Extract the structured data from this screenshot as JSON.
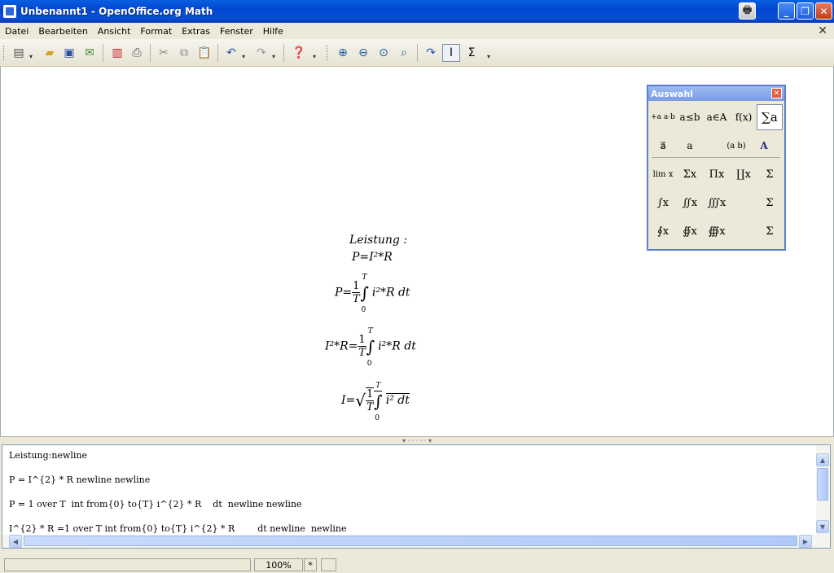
{
  "window": {
    "title": "Unbenannt1 - OpenOffice.org Math"
  },
  "menubar": {
    "items": [
      {
        "label": "Datei"
      },
      {
        "label": "Bearbeiten"
      },
      {
        "label": "Ansicht"
      },
      {
        "label": "Format"
      },
      {
        "label": "Extras"
      },
      {
        "label": "Fenster"
      },
      {
        "label": "Hilfe"
      }
    ],
    "close_glyph": "✕"
  },
  "toolbar": {
    "icons": [
      "new-document-icon",
      "open-folder-icon",
      "save-icon",
      "mail-icon",
      "export-pdf-icon",
      "print-icon",
      "cut-icon",
      "copy-icon",
      "paste-icon",
      "undo-icon",
      "redo-icon",
      "help-icon",
      "zoom-in-icon",
      "zoom-out-icon",
      "zoom-100-icon",
      "zoom-icon",
      "update-icon",
      "formula-cursor-icon",
      "selection-sigma-icon"
    ],
    "sigma_label": "Σ"
  },
  "formulas": {
    "leistung": "Leistung :",
    "f1": "P=I²*R",
    "f2_left": "P=",
    "f2_num": "1",
    "f2_den": "T",
    "f2_up": "T",
    "f2_lo": "0",
    "f2_right": "i²*R dt",
    "f3_left": "I²*R=",
    "f3_num": "1",
    "f3_den": "T",
    "f3_up": "T",
    "f3_lo": "0",
    "f3_right": "i²*R dt",
    "f4_left": "I=",
    "f4_num": "1",
    "f4_den": "T",
    "f4_up": "T",
    "f4_lo": "0",
    "f4_right": "i² dt"
  },
  "auswahl": {
    "title": "Auswahl",
    "categories": [
      "+a a·b",
      "a≤b",
      "a∈A",
      "f(x)",
      "∑a",
      "a⃗",
      "a",
      "(a b)",
      "A"
    ],
    "symbols": [
      "lim x",
      "Σx",
      "Πx",
      "∐x",
      "Σ",
      "∫x",
      "∬x",
      "∭x",
      "Σ",
      "∮x",
      "∯x",
      "∰x",
      "Σ"
    ]
  },
  "commands": {
    "lines": [
      "Leistung:newline",
      "P = I^{2} * R newline newline",
      "P = 1 over T  int from{0} to{T} i^{2} * R    dt  newline newline",
      "I^{2} * R =1 over T int from{0} to{T} i^{2} * R        dt newline  newline"
    ]
  },
  "status": {
    "zoom": "100%",
    "modified": "*"
  },
  "colors": {
    "titlebar": "#0047d0",
    "window_bg": "#ece9d8"
  }
}
